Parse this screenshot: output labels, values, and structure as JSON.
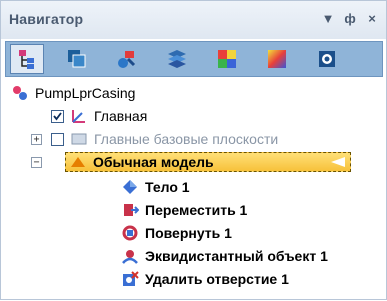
{
  "panel": {
    "title": "Навигатор",
    "controls": {
      "pin": "▼",
      "dock": "ф",
      "close": "×"
    }
  },
  "toolbar": {
    "tools": [
      {
        "icon": "tree-structure-icon",
        "selected": true
      },
      {
        "icon": "layers-copy-icon",
        "selected": false
      },
      {
        "icon": "parts-icon",
        "selected": false
      },
      {
        "icon": "stack-icon",
        "selected": false
      },
      {
        "icon": "color-grid-icon",
        "selected": false
      },
      {
        "icon": "gradient-icon",
        "selected": false
      },
      {
        "icon": "settings-icon",
        "selected": false
      }
    ]
  },
  "tree": {
    "root": "PumpLprCasing",
    "main": "Главная",
    "planes": "Главные базовые плоскости",
    "model": "Обычная модель",
    "items": [
      "Тело 1",
      "Переместить 1",
      "Повернуть 1",
      "Эквидистантный объект 1",
      "Удалить отверстие 1"
    ]
  },
  "colors": {
    "highlight": "#f7c13a",
    "toolbar": "#8fb4d8",
    "title": "#4a5a70"
  }
}
